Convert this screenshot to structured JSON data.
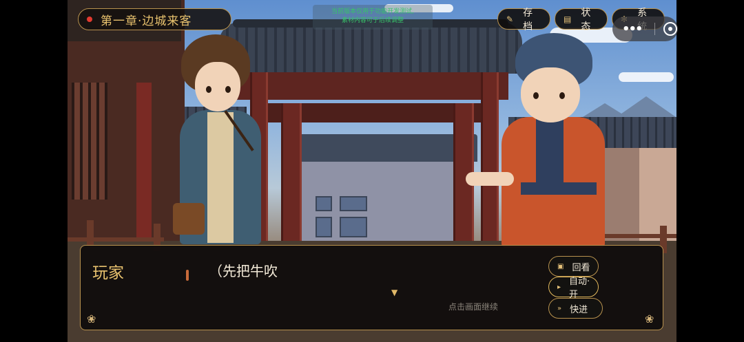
{
  "chapter": {
    "title": "第一章·边城来客"
  },
  "notice": {
    "line1": "当前版本仅用于功能开发测试,",
    "line2": "素材内容可于后续调整"
  },
  "top_menu": [
    {
      "label": "存档",
      "icon": "save-icon"
    },
    {
      "label": "状态",
      "icon": "scroll-icon"
    },
    {
      "label": "系统",
      "icon": "gear-icon"
    }
  ],
  "dialogue": {
    "speaker": "玩家",
    "text": "（先把牛吹",
    "continue_hint": "点击画面继续"
  },
  "side_menu": [
    {
      "label": "回看",
      "icon": "book-icon"
    },
    {
      "label": "自动·开",
      "icon": "play-icon"
    },
    {
      "label": "快进",
      "icon": "fast-forward-icon"
    }
  ],
  "colors": {
    "accent_gold": "#b8924e",
    "title_gold": "#e8c26e",
    "panel_bg": "#0e0c0c"
  }
}
